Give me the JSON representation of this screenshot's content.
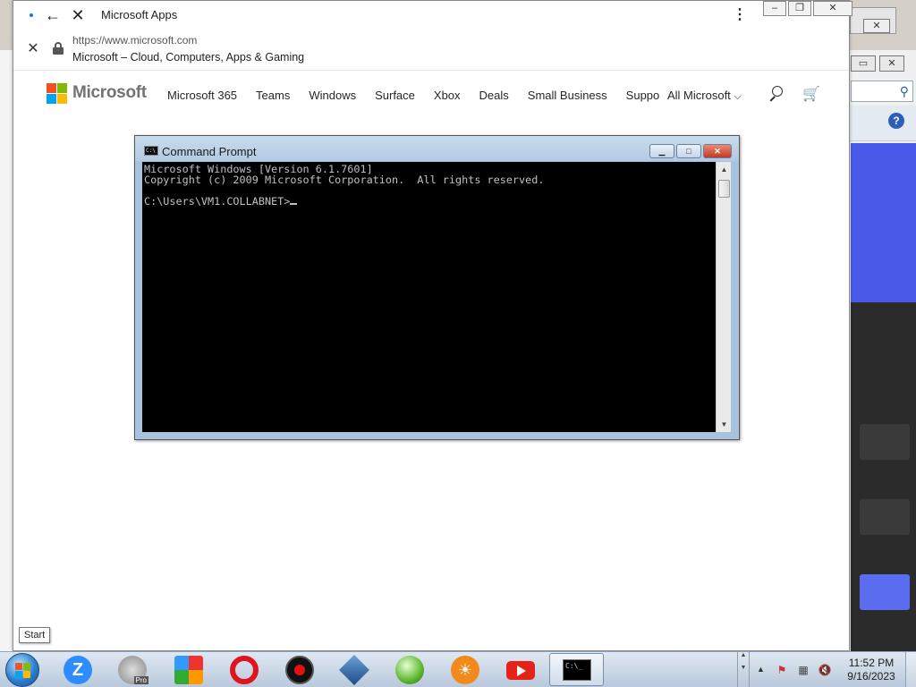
{
  "browser": {
    "tab_title": "Microsoft Apps",
    "url": "https://www.microsoft.com",
    "page_title": "Microsoft – Cloud, Computers, Apps & Gaming"
  },
  "msnav": {
    "brand": "Microsoft",
    "links": [
      "Microsoft 365",
      "Teams",
      "Windows",
      "Surface",
      "Xbox",
      "Deals",
      "Small Business",
      "Suppo"
    ],
    "all_microsoft": "All Microsoft",
    "chevron": "⌵"
  },
  "cmd": {
    "title": "Command Prompt",
    "line1": "Microsoft Windows [Version 6.1.7601]",
    "line2": "Copyright (c) 2009 Microsoft Corporation.  All rights reserved.",
    "line3": "",
    "prompt": "C:\\Users\\VM1.COLLABNET>"
  },
  "tooltip": {
    "start": "Start"
  },
  "taskbar": {
    "zoom_letter": "Z",
    "pro_badge": "Pro",
    "cmd_icon_text": "C:\\_",
    "time": "11:52 PM",
    "date": "9/16/2023"
  },
  "colors": {
    "ms_red": "#f25022",
    "ms_green": "#7fba00",
    "ms_blue": "#00a4ef",
    "ms_yellow": "#ffb900",
    "console_bg": "#000000",
    "console_text": "#c0c0c0"
  }
}
